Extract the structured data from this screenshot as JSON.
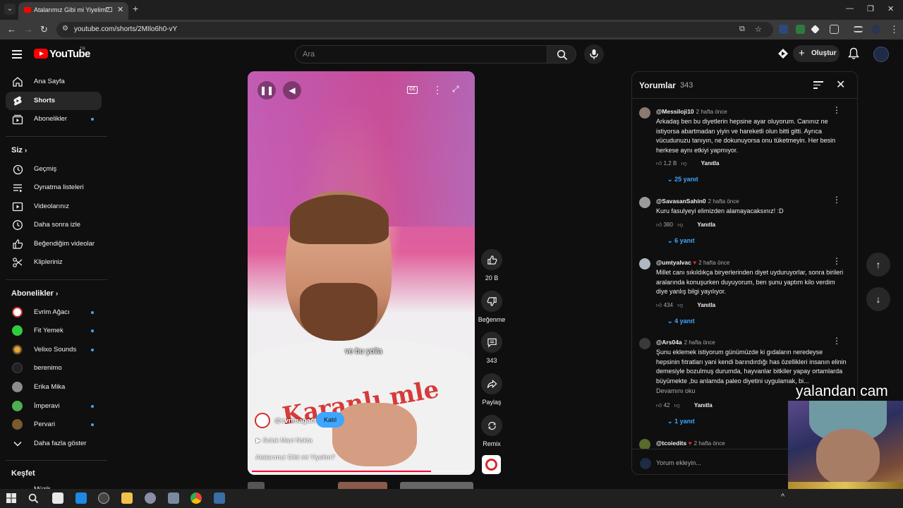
{
  "browser": {
    "tab_title": "Atalarımız Gibi mi Yiyelim?",
    "url": "youtube.com/shorts/2MIlo6h0-vY",
    "ext_badge_1": "90",
    "ext_badge_2": "17"
  },
  "header": {
    "logo_text": "YouTube",
    "logo_suffix": "TR",
    "search_placeholder": "Ara",
    "create_label": "Oluştur"
  },
  "sidebar": {
    "main": [
      {
        "label": "Ana Sayfa",
        "icon": "home-icon"
      },
      {
        "label": "Shorts",
        "icon": "shorts-icon",
        "active": true
      },
      {
        "label": "Abonelikler",
        "icon": "subscriptions-icon"
      }
    ],
    "you_heading": "Siz",
    "you_items": [
      {
        "label": "Geçmiş",
        "icon": "history-icon"
      },
      {
        "label": "Oynatma listeleri",
        "icon": "playlists-icon"
      },
      {
        "label": "Videolarınız",
        "icon": "your-videos-icon"
      },
      {
        "label": "Daha sonra izle",
        "icon": "watch-later-icon"
      },
      {
        "label": "Beğendiğim videolar",
        "icon": "liked-icon"
      },
      {
        "label": "Klipleriniz",
        "icon": "clips-icon"
      }
    ],
    "subs_heading": "Abonelikler",
    "subs": [
      {
        "label": "Evrim Ağacı",
        "color": "#ffffff"
      },
      {
        "label": "Fit Yemek",
        "color": "#2ecc40"
      },
      {
        "label": "Velixo Sounds",
        "color": "#c98a2a"
      },
      {
        "label": "berenimo",
        "color": "#222222"
      },
      {
        "label": "Erika Mika",
        "color": "#8c8c8c"
      },
      {
        "label": "İmperavi",
        "color": "#4caf50"
      },
      {
        "label": "Pervari",
        "color": "#7a5a2e"
      }
    ],
    "show_more": "Daha fazla göster",
    "explore_heading": "Keşfet",
    "explore_partial": "Müzik"
  },
  "video": {
    "caption": "ve bu yolla",
    "channel": "@evrimagaci",
    "join_label": "Katıl",
    "sound": "Soluk Mavi Nokta",
    "title": "Atalarımız Gibi mi Yiyelim?",
    "progress": 0.82,
    "shirt_print": "Karanlı mle"
  },
  "actions": {
    "likes": "20 B",
    "dislike": "Beğenme",
    "comments": "343",
    "share": "Paylaş",
    "remix": "Remix"
  },
  "comments_panel": {
    "title": "Yorumlar",
    "count": "343",
    "reply_label": "Yanıtla",
    "add_placeholder": "Yorum ekleyin...",
    "comments": [
      {
        "user": "@Messiloji10",
        "when": "2 hafta önce",
        "text": "Arkadaş ben bu diyetlerin hepsine ayar oluyorum. Canınız ne istiyorsa abartmadan yiyin ve hareketli olun bitti gitti. Ayrıca vücudunuzu tanıyın, ne dokunuyorsa onu tüketmeyin. Her besin herkese aynı etkiyi yapmıyor.",
        "likes": "1,2 B",
        "replies": "25 yanıt"
      },
      {
        "user": "@SavasanSahin0",
        "when": "2 hafta önce",
        "text": "Kuru fasulyeyi elimizden alamayacaksınız! :D",
        "likes": "380",
        "replies": "6 yanıt"
      },
      {
        "user": "@umtyalvac",
        "when": "2 hafta önce",
        "text": "Millet canı sıkıldıkça biryerlerinden diyet uyduruyorlar, sonra birileri aralarında konuşurken duyuyorum, ben şunu yaptım kilo verdim diye yanlış bilgi yayılıyor.",
        "likes": "434",
        "replies": "4 yanıt"
      },
      {
        "user": "@Ars04a",
        "when": "2 hafta önce",
        "text": "Şunu eklemek istiyorum günümüzde ki gıdaların neredeyse hepsinin fıtratları yani kendi barındırdığı has özellikleri insanın elinin demesiyle bozulmuş durumda, hayvanlar bitkiler yapay ortamlarda büyümekte ,bu anlamda paleo diyetini uygulamak, bi...",
        "more": "Devamını oku",
        "likes": "42",
        "replies": "1 yanıt"
      },
      {
        "user": "@tcoiedits",
        "when": "2 hafta önce"
      }
    ]
  },
  "overlay": {
    "cam_label": "yalandan cam"
  }
}
